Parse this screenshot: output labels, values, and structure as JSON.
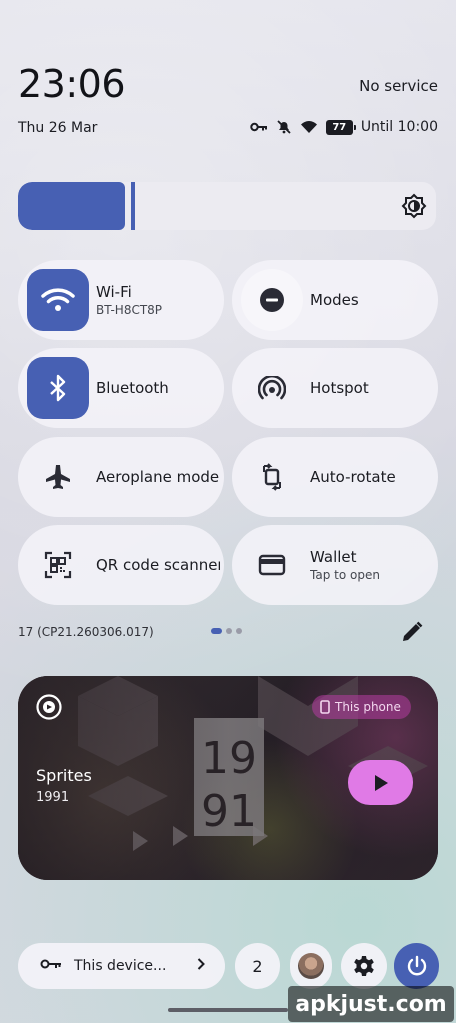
{
  "status": {
    "time": "23:06",
    "carrier": "No service",
    "date": "Thu 26 Mar",
    "battery_level": "77",
    "alarm_text": "Until 10:00"
  },
  "brightness": {
    "level": 0.27
  },
  "tiles": [
    {
      "label": "Wi-Fi",
      "sublabel": "BT-H8CT8P",
      "icon": "wifi-icon",
      "active": true
    },
    {
      "label": "Modes",
      "sublabel": "",
      "icon": "modes-icon",
      "active": false
    },
    {
      "label": "Bluetooth",
      "sublabel": "",
      "icon": "bluetooth-icon",
      "active": true
    },
    {
      "label": "Hotspot",
      "sublabel": "",
      "icon": "hotspot-icon",
      "active": false
    },
    {
      "label": "Aeroplane mode",
      "sublabel": "",
      "icon": "airplane-icon",
      "active": false
    },
    {
      "label": "Auto-rotate",
      "sublabel": "",
      "icon": "auto-rotate-icon",
      "active": false
    },
    {
      "label": "QR code scanner",
      "sublabel": "",
      "icon": "qr-code-icon",
      "active": false
    },
    {
      "label": "Wallet",
      "sublabel": "Tap to open",
      "icon": "wallet-icon",
      "active": false
    }
  ],
  "build_number": "17 (CP21.260306.017)",
  "page_indicator": {
    "pages": 3,
    "current": 1
  },
  "media": {
    "title": "Sprites",
    "artist": "1991",
    "output_device": "This phone",
    "art_text": "1991"
  },
  "bottom_bar": {
    "device_label": "This device...",
    "notification_count": "2"
  },
  "watermark": "apkjust.com",
  "colors": {
    "accent": "#4760b3",
    "media_play": "#e07ae6",
    "tile_bg": "#f4f3f8"
  }
}
